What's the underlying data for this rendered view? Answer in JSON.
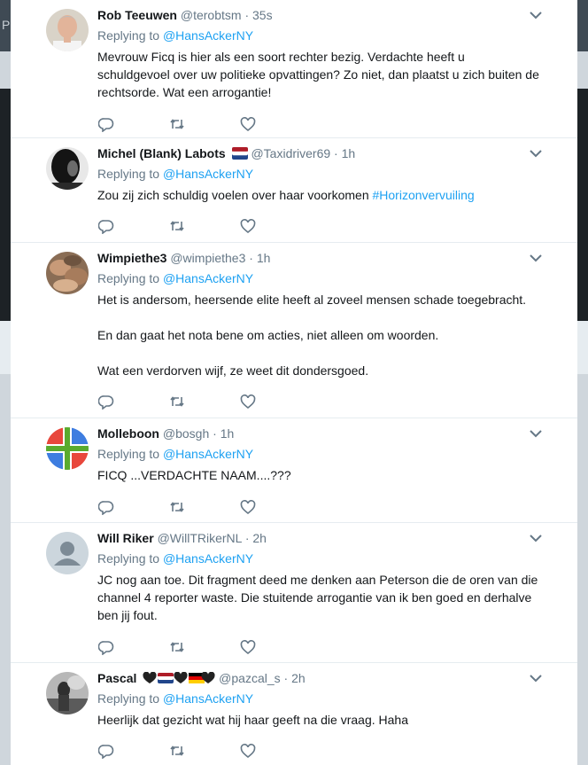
{
  "background": {
    "fragment": "P"
  },
  "tweets": [
    {
      "name": "Rob Teeuwen",
      "handle": "@terobtsm",
      "time": "35s",
      "replying_label": "Replying to",
      "replying_to": "@HansAckerNY",
      "text": "Mevrouw Ficq is hier als een soort rechter bezig. Verdachte heeft u schuldgevoel over uw politieke opvattingen? Zo niet, dan plaatst u zich buiten de rechtsorde. Wat een arrogantie!"
    },
    {
      "name": "Michel (Blank) Labots",
      "handle": "@Taxidriver69",
      "time": "1h",
      "replying_label": "Replying to",
      "replying_to": "@HansAckerNY",
      "text": "Zou zij zich schuldig voelen over haar voorkomen ",
      "hashtag": "#Horizonvervuiling",
      "emoji": [
        "flag-netherlands-icon"
      ]
    },
    {
      "name": "Wimpiethe3",
      "handle": "@wimpiethe3",
      "time": "1h",
      "replying_label": "Replying to",
      "replying_to": "@HansAckerNY",
      "paragraphs": [
        "Het is andersom, heersende elite heeft al zoveel mensen schade toegebracht.",
        "En dan gaat het nota bene om acties, niet alleen om woorden.",
        "Wat een verdorven wijf, ze weet dit dondersgoed."
      ]
    },
    {
      "name": "Molleboon",
      "handle": "@bosgh",
      "time": "1h",
      "replying_label": "Replying to",
      "replying_to": "@HansAckerNY",
      "text": "FICQ ...VERDACHTE NAAM....???"
    },
    {
      "name": "Will Riker",
      "handle": "@WillTRikerNL",
      "time": "2h",
      "replying_label": "Replying to",
      "replying_to": "@HansAckerNY",
      "text": "JC nog aan toe. Dit fragment deed me denken aan Peterson die de oren van die channel 4 reporter waste. Die stuitende arrogantie van ik ben goed en derhalve ben jij fout."
    },
    {
      "name": "Pascal",
      "handle": "@pazcal_s",
      "time": "2h",
      "replying_label": "Replying to",
      "replying_to": "@HansAckerNY",
      "text": "Heerlijk dat gezicht wat hij haar geeft na die vraag. Haha",
      "emoji": [
        "black-heart-icon",
        "flag-netherlands-icon",
        "black-heart-icon",
        "flag-germany-icon",
        "black-heart-icon"
      ]
    }
  ],
  "colors": {
    "link": "#1da1f2",
    "secondary": "#657786",
    "text": "#14171a",
    "divider": "#e6ecf0"
  },
  "actions": [
    "reply-icon",
    "retweet-icon",
    "like-icon"
  ]
}
